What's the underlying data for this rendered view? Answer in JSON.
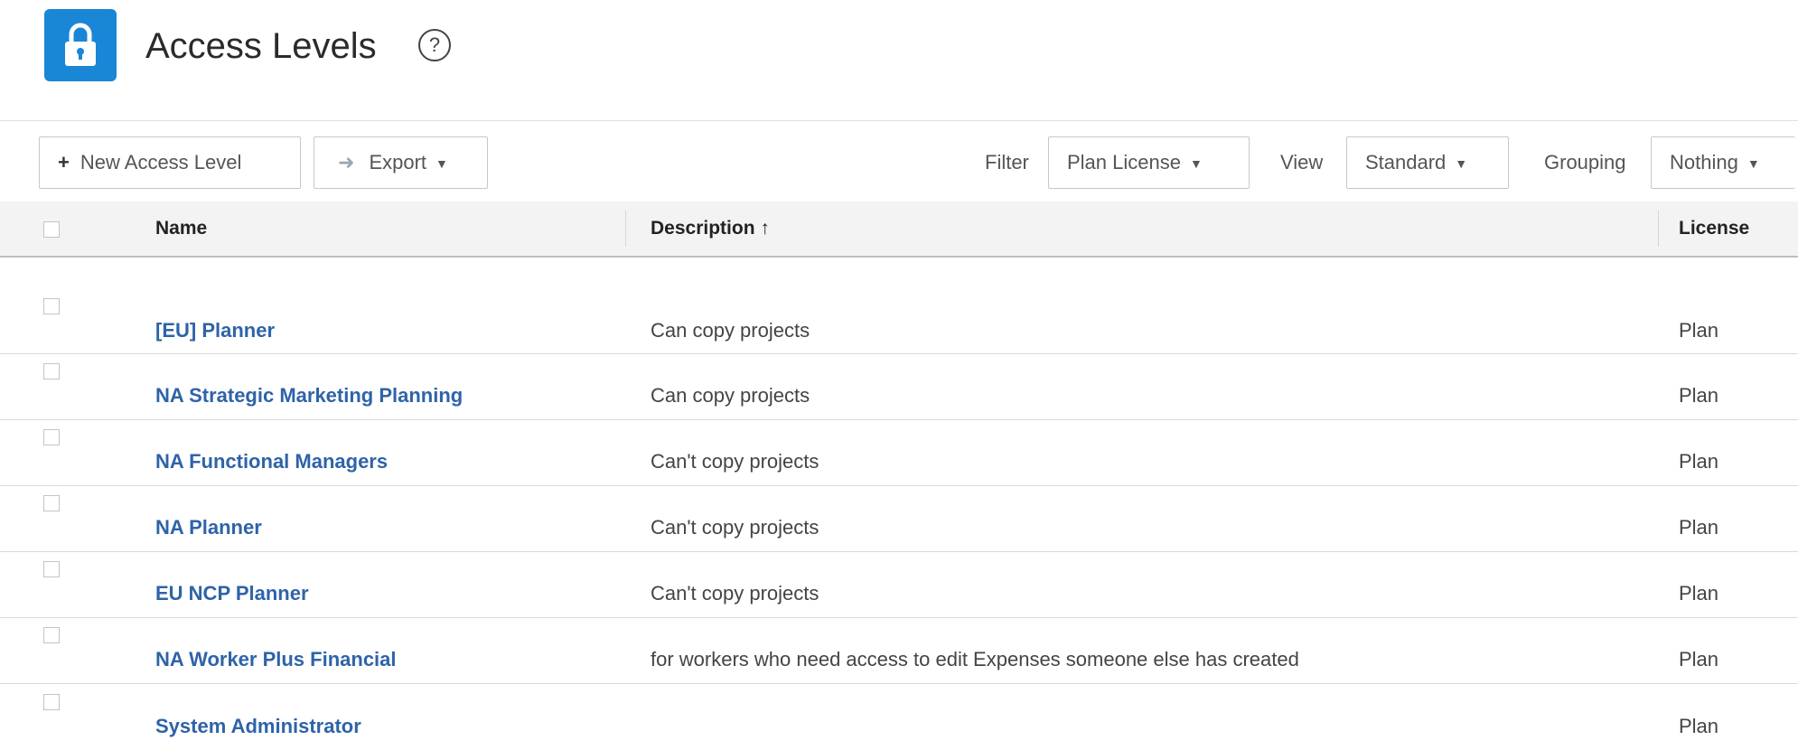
{
  "header": {
    "title": "Access Levels",
    "app_icon": "lock-icon",
    "help_glyph": "?",
    "brand_color": "#1a86d6"
  },
  "toolbar": {
    "new_label": "New Access Level",
    "new_icon": "plus-icon",
    "export_label": "Export",
    "export_icon": "arrow-right-icon",
    "filter_label": "Filter",
    "filter_value": "Plan License",
    "view_label": "View",
    "view_value": "Standard",
    "grouping_label": "Grouping",
    "grouping_value": "Nothing"
  },
  "table": {
    "columns": {
      "name": "Name",
      "description": "Description",
      "description_sort": "↑",
      "license": "License"
    },
    "rows": [
      {
        "name": "[EU] Planner",
        "description": "Can copy projects",
        "license": "Plan"
      },
      {
        "name": "NA Strategic Marketing Planning",
        "description": "Can copy projects",
        "license": "Plan"
      },
      {
        "name": "NA Functional Managers",
        "description": "Can't copy projects",
        "license": "Plan"
      },
      {
        "name": "NA Planner",
        "description": "Can't copy projects",
        "license": "Plan"
      },
      {
        "name": "EU NCP Planner",
        "description": "Can't copy projects",
        "license": "Plan"
      },
      {
        "name": "NA Worker Plus Financial",
        "description": "for workers who need access to edit Expenses someone else has created",
        "license": "Plan"
      },
      {
        "name": "System Administrator",
        "description": "",
        "license": "Plan"
      }
    ],
    "link_color": "#2e63a8"
  }
}
